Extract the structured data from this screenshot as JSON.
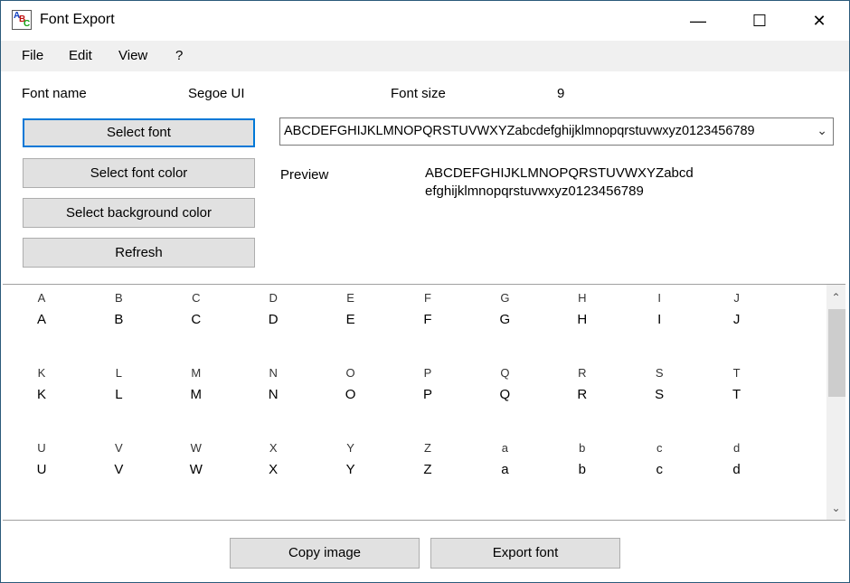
{
  "window": {
    "title": "Font Export",
    "icon": "abc-app-icon",
    "minimize": "—",
    "maximize": "☐",
    "close": "✕"
  },
  "menu": [
    "File",
    "Edit",
    "View",
    "?"
  ],
  "font": {
    "name_label": "Font name",
    "name_value": "Segoe UI",
    "size_label": "Font size",
    "size_value": "9"
  },
  "buttons": {
    "select_font": "Select font",
    "select_font_color": "Select font color",
    "select_bg_color": "Select background color",
    "refresh": "Refresh",
    "copy_image": "Copy image",
    "export_font": "Export font"
  },
  "sample_combo": {
    "value": "ABCDEFGHIJKLMNOPQRSTUVWXYZabcdefghijklmnopqrstuvwxyz0123456789"
  },
  "preview": {
    "label": "Preview",
    "line1": "ABCDEFGHIJKLMNOPQRSTUVWXYZabcd",
    "line2": "efghijklmnopqrstuvwxyz0123456789"
  },
  "glyphs": [
    "A",
    "B",
    "C",
    "D",
    "E",
    "F",
    "G",
    "H",
    "I",
    "J",
    "K",
    "L",
    "M",
    "N",
    "O",
    "P",
    "Q",
    "R",
    "S",
    "T",
    "U",
    "V",
    "W",
    "X",
    "Y",
    "Z",
    "a",
    "b",
    "c",
    "d"
  ]
}
